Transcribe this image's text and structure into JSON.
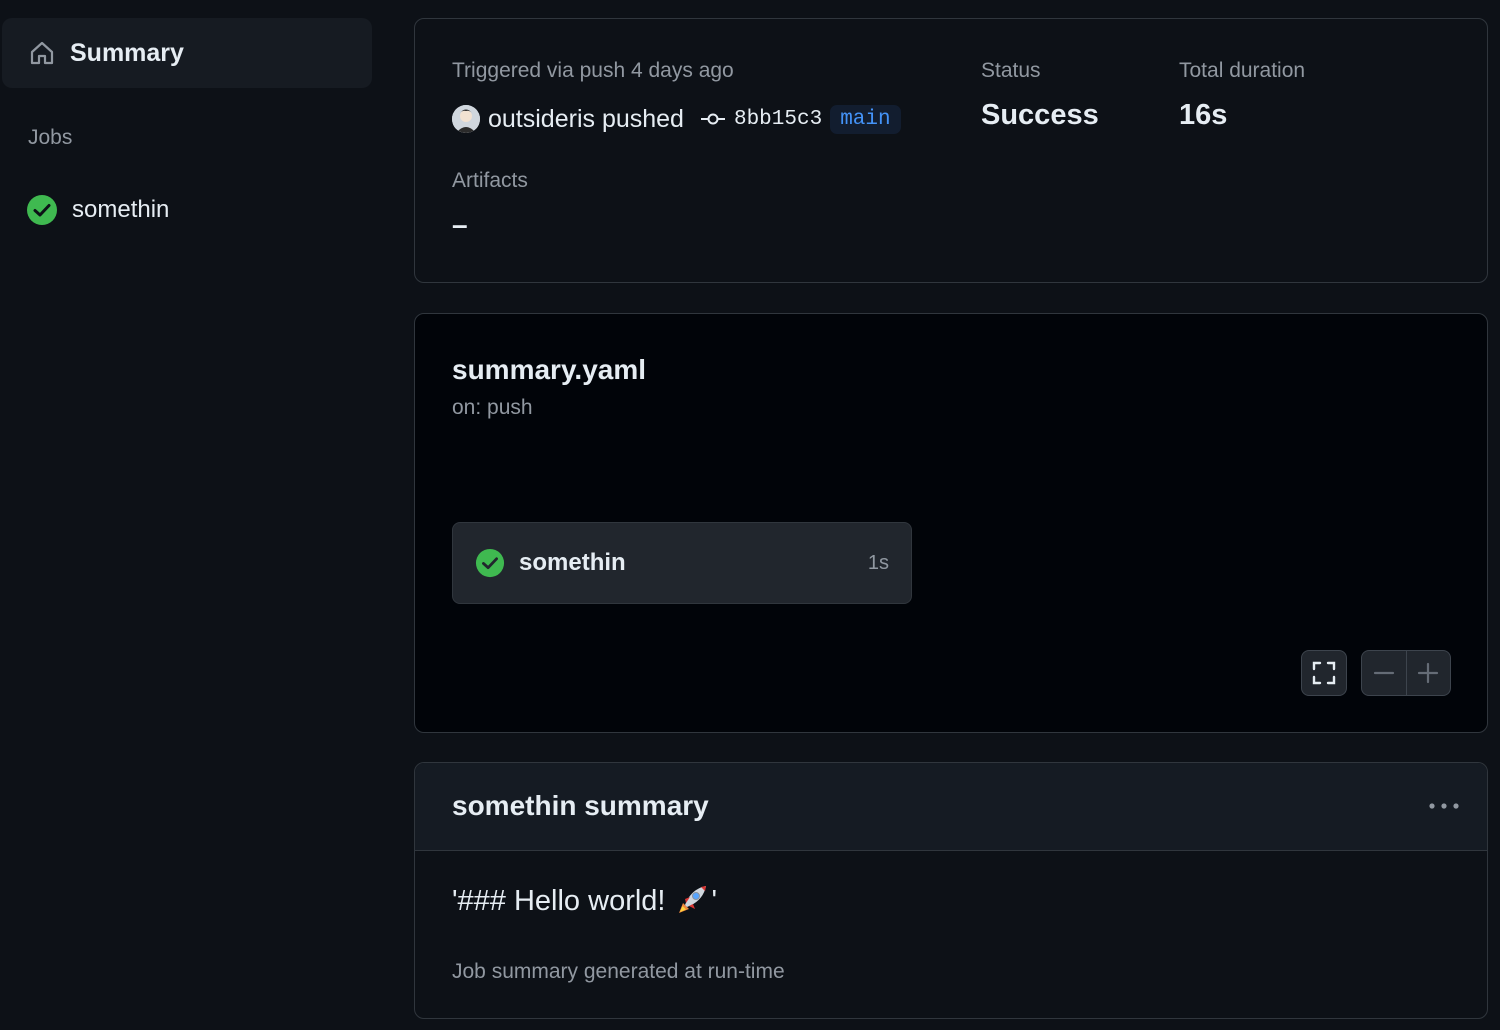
{
  "sidebar": {
    "summary_label": "Summary",
    "jobs_heading": "Jobs",
    "jobs": [
      {
        "label": "somethin",
        "status": "success"
      }
    ]
  },
  "run_info": {
    "triggered_text": "Triggered via push 4 days ago",
    "pusher_text": "outsideris pushed",
    "commit_sha": "8bb15c3",
    "branch": "main",
    "status_label": "Status",
    "status_value": "Success",
    "duration_label": "Total duration",
    "duration_value": "16s",
    "artifacts_label": "Artifacts",
    "artifacts_value": "–"
  },
  "workflow_graph": {
    "workflow_name": "summary.yaml",
    "trigger": "on: push",
    "job": {
      "label": "somethin",
      "duration": "1s",
      "status": "success"
    }
  },
  "job_summary": {
    "title": "somethin summary",
    "heading_text_before": "'### Hello world!",
    "heading_text_after": "'",
    "footer": "Job summary generated at run-time"
  },
  "colors": {
    "background": "#0d1117",
    "success": "#3fb950",
    "accent_blue": "#4493f8"
  },
  "icons": [
    "home-icon",
    "check-circle-icon",
    "commit-icon",
    "fullscreen-icon",
    "minus-icon",
    "plus-icon",
    "kebab-icon",
    "rocket-icon"
  ]
}
